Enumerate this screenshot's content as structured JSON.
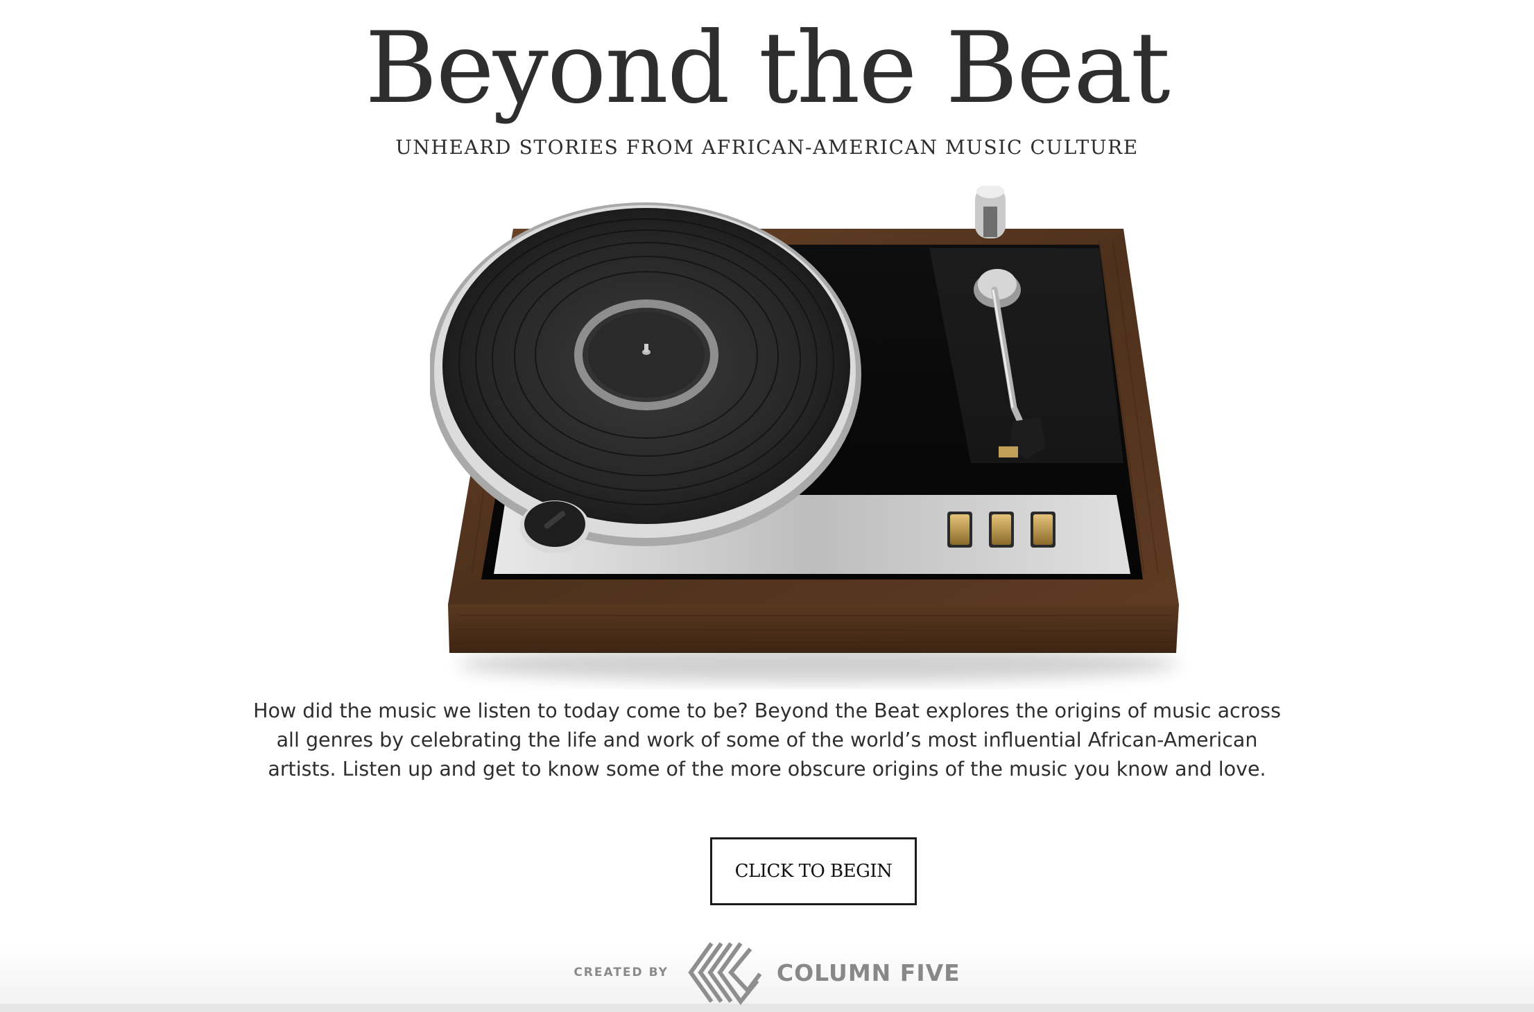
{
  "header": {
    "title": "Beyond the Beat",
    "subtitle": "UNHEARD STORIES FROM AFRICAN-AMERICAN MUSIC CULTURE"
  },
  "hero": {
    "image_name": "turntable-illustration",
    "colors": {
      "wood": "#5a3a24",
      "platter": "#2b2b2b",
      "silver": "#cfcfcf",
      "gold": "#b89448"
    }
  },
  "intro": {
    "text": "How did the music we listen to today come to be? Beyond the Beat explores the origins of music across all genres by celebrating the life and work of some of the world’s most influential African-American artists. Listen up and get to know some of the more obscure origins of the music you know and love."
  },
  "cta": {
    "label": "CLICK TO BEGIN"
  },
  "footer": {
    "created_by": "CREATED BY",
    "brand": "COLUMN FIVE",
    "logo_icon": "column-five-logo-icon"
  }
}
